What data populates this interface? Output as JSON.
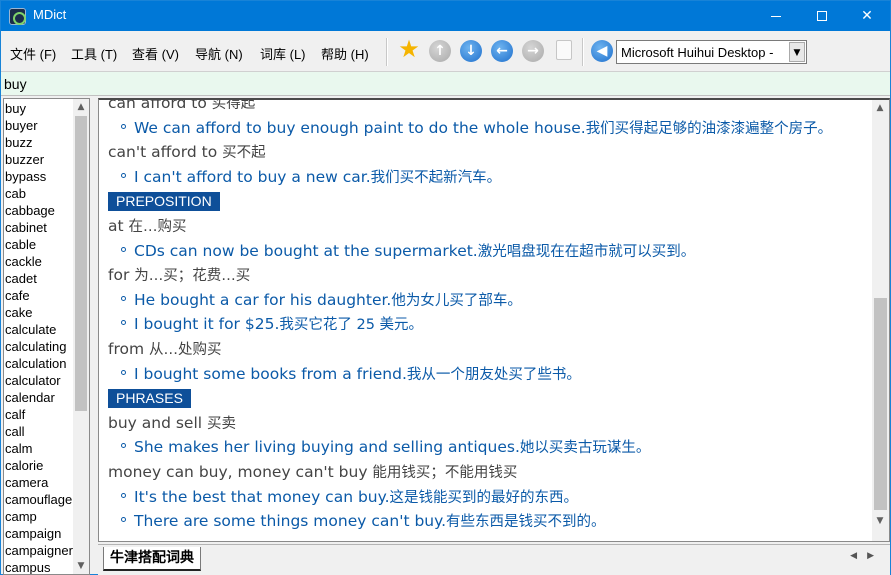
{
  "window": {
    "title": "MDict"
  },
  "menu": [
    "文件 (F)",
    "工具 (T)",
    "查看 (V)",
    "导航 (N)",
    "词库 (L)",
    "帮助 (H)"
  ],
  "toolbar": {
    "dictionary_selected": "Microsoft Huihui Desktop -"
  },
  "search": {
    "value": "buy"
  },
  "wordlist": [
    "buy",
    "buyer",
    "buzz",
    "buzzer",
    "bypass",
    "cab",
    "cabbage",
    "cabinet",
    "cable",
    "cackle",
    "cadet",
    "cafe",
    "cake",
    "calculate",
    "calculating",
    "calculation",
    "calculator",
    "calendar",
    "calf",
    "call",
    "calm",
    "calorie",
    "camera",
    "camouflage",
    "camp",
    "campaign",
    "campaigner",
    "campus"
  ],
  "entry": {
    "lines": [
      {
        "type": "phrase",
        "en": "can afford to",
        "cn": "买得起"
      },
      {
        "type": "example",
        "en": "We can afford to buy enough paint to do the whole house.",
        "cn": "我们买得起足够的油漆漆遍整个房子。"
      },
      {
        "type": "phrase",
        "en": "can't afford to",
        "cn": "买不起"
      },
      {
        "type": "example",
        "en": "I can't afford to buy a new car.",
        "cn": "我们买不起新汽车。"
      },
      {
        "type": "badge",
        "text": "PREPOSITION"
      },
      {
        "type": "phrase",
        "en": "at",
        "cn": "在…购买"
      },
      {
        "type": "example",
        "en": "CDs can now be bought at the supermarket.",
        "cn": "激光唱盘现在在超市就可以买到。"
      },
      {
        "type": "phrase",
        "en": "for",
        "cn": "为…买；花费…买"
      },
      {
        "type": "example",
        "en": "He bought a car for his daughter.",
        "cn": "他为女儿买了部车。"
      },
      {
        "type": "example",
        "en": "I bought it for $25.",
        "cn": "我买它花了 25 美元。"
      },
      {
        "type": "phrase",
        "en": "from",
        "cn": "从…处购买"
      },
      {
        "type": "example",
        "en": "I bought some books from a friend.",
        "cn": "我从一个朋友处买了些书。"
      },
      {
        "type": "badge",
        "text": "PHRASES"
      },
      {
        "type": "phrase",
        "en": "buy and sell",
        "cn": "买卖"
      },
      {
        "type": "example",
        "en": "She makes her living buying and selling antiques.",
        "cn": "她以买卖古玩谋生。"
      },
      {
        "type": "phrase",
        "en": "money can buy, money can't buy",
        "cn": "能用钱买；不能用钱买"
      },
      {
        "type": "example",
        "en": "It's the best that money can buy.",
        "cn": "这是钱能买到的最好的东西。"
      },
      {
        "type": "example",
        "en": "There are some things money can't buy.",
        "cn": "有些东西是钱买不到的。"
      }
    ]
  },
  "tabs": [
    "牛津搭配词典"
  ]
}
